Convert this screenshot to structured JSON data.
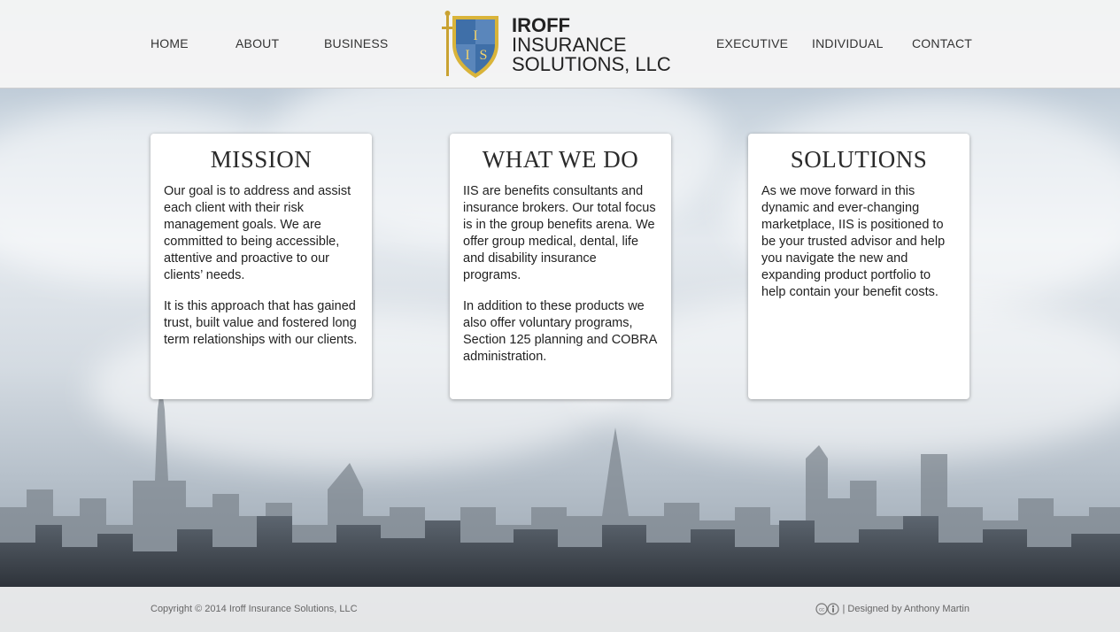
{
  "nav": {
    "left": [
      {
        "label": "HOME"
      },
      {
        "label": "ABOUT"
      },
      {
        "label": "BUSINESS"
      }
    ],
    "right": [
      {
        "label": "EXECUTIVE"
      },
      {
        "label": "INDIVIDUAL"
      },
      {
        "label": "CONTACT"
      }
    ]
  },
  "logo": {
    "line1": "IROFF",
    "line2": "INSURANCE",
    "line3": "SOLUTIONS, LLC",
    "shield_letters": "IIS",
    "icon": "shield-with-sword-icon"
  },
  "cards": [
    {
      "title": "MISSION",
      "paragraphs": [
        "Our goal is to address and assist each client with their risk management goals. We are committed to being accessible, attentive and proactive to our clients’ needs.",
        "It is this approach that has gained trust, built value and fostered long term relationships with our clients."
      ]
    },
    {
      "title": "WHAT WE DO",
      "paragraphs": [
        "IIS are benefits consultants and insurance brokers. Our total focus is in the group benefits arena. We offer group medical, dental, life and disability insurance programs.",
        "In addition to these products we also offer voluntary programs, Section 125 planning and COBRA administration."
      ]
    },
    {
      "title": "SOLUTIONS",
      "paragraphs": [
        "As we move forward in this dynamic and ever-changing marketplace, IIS is positioned to be your trusted advisor and help you navigate the new and expanding product portfolio to help contain your benefit costs."
      ]
    }
  ],
  "footer": {
    "copyright": "Copyright © 2014 Iroff Insurance Solutions, LLC",
    "designed_by": "| Designed by Anthony Martin",
    "license_icon": "creative-commons-icon"
  },
  "colors": {
    "header_bg": "#f5f5f5",
    "shield_blue": "#3f6fa8",
    "shield_gold": "#d9b43a"
  }
}
